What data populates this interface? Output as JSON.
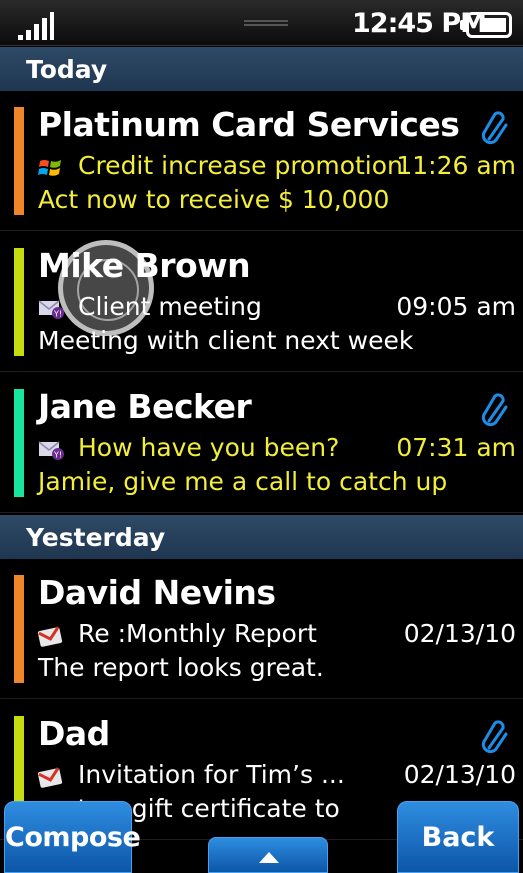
{
  "status_bar": {
    "time": "12:45 PM"
  },
  "sections": {
    "today": "Today",
    "yesterday": "Yesterday"
  },
  "colors": {
    "orange": "#f0862a",
    "lime": "#c6dc10",
    "teal": "#18e6a0",
    "unread_text": "#f2ee3a",
    "accent_blue": "#1d74d0"
  },
  "messages": [
    {
      "sender": "Platinum Card Services",
      "subject": "Credit increase promotion",
      "time": "11:26 am",
      "preview": "Act now to receive $ 10,000",
      "icon": "windows-logo-icon",
      "attachment": true,
      "unread": true
    },
    {
      "sender": "Mike Brown",
      "subject": "Client meeting",
      "time": "09:05 am",
      "preview": "Meeting with client next week",
      "icon": "yahoo-mail-icon",
      "attachment": false,
      "unread": false
    },
    {
      "sender": "Jane Becker",
      "subject": "How have you been?",
      "time": "07:31 am",
      "preview": "Jamie, give me a call to catch up",
      "icon": "yahoo-mail-icon",
      "attachment": true,
      "unread": true
    },
    {
      "sender": "David Nevins",
      "subject": "Re :Monthly Report",
      "time": "02/13/10",
      "preview": "The report looks great.",
      "icon": "gmail-icon",
      "attachment": false,
      "unread": false
    },
    {
      "sender": "Dad",
      "subject": "Invitation for  Tim’s ...",
      "time": "02/13/10",
      "preview": "...nts a gift certificate to",
      "icon": "gmail-icon",
      "attachment": true,
      "unread": false
    }
  ],
  "buttons": {
    "compose": "Compose",
    "back": "Back"
  }
}
